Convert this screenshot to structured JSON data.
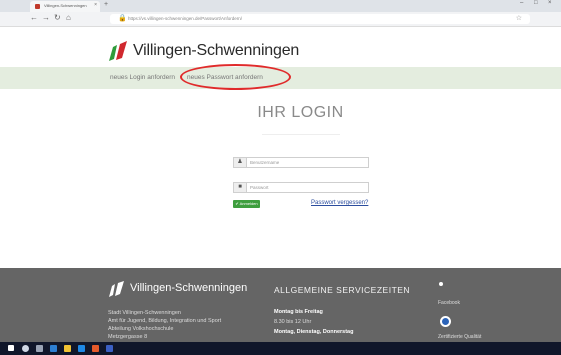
{
  "browser": {
    "tab_title": "Villingen-Schwenningen",
    "url": "https://vs.villingen-schwenningen.de/Passwort/Anfordern/"
  },
  "site": {
    "logo_text": "Villingen-Schwenningen",
    "subnav": {
      "new_login": "neues Login anfordern",
      "new_password": "neues Passwort anfordern"
    }
  },
  "login": {
    "title": "IHR LOGIN",
    "username_placeholder": "Benutzername",
    "password_placeholder": "Passwort",
    "submit_label": "✔ Anmelden",
    "forgot_link": "Passwort vergessen?"
  },
  "footer": {
    "logo_text": "Villingen-Schwenningen",
    "address": [
      "Stadt Villingen-Schwenningen",
      "Amt für Jugend, Bildung, Integration und Sport",
      "Abteilung Volkshochschule",
      "Metzgergasse 8"
    ],
    "service_heading": "ALLGEMEINE SERVICEZEITEN",
    "hours_1_label": "Montag bis Freitag",
    "hours_1_time": "8.30 bis 12 Uhr",
    "hours_2_label": "Montag, Dienstag, Donnerstag",
    "facebook": "Facebook",
    "quality": "Zertifizierte Qualität"
  },
  "colors": {
    "subnav_bg": "#e4eddf",
    "footer_bg": "#656565",
    "submit_bg": "#3e9e3e",
    "link": "#2b4d9e",
    "highlight": "#e02b2b"
  }
}
